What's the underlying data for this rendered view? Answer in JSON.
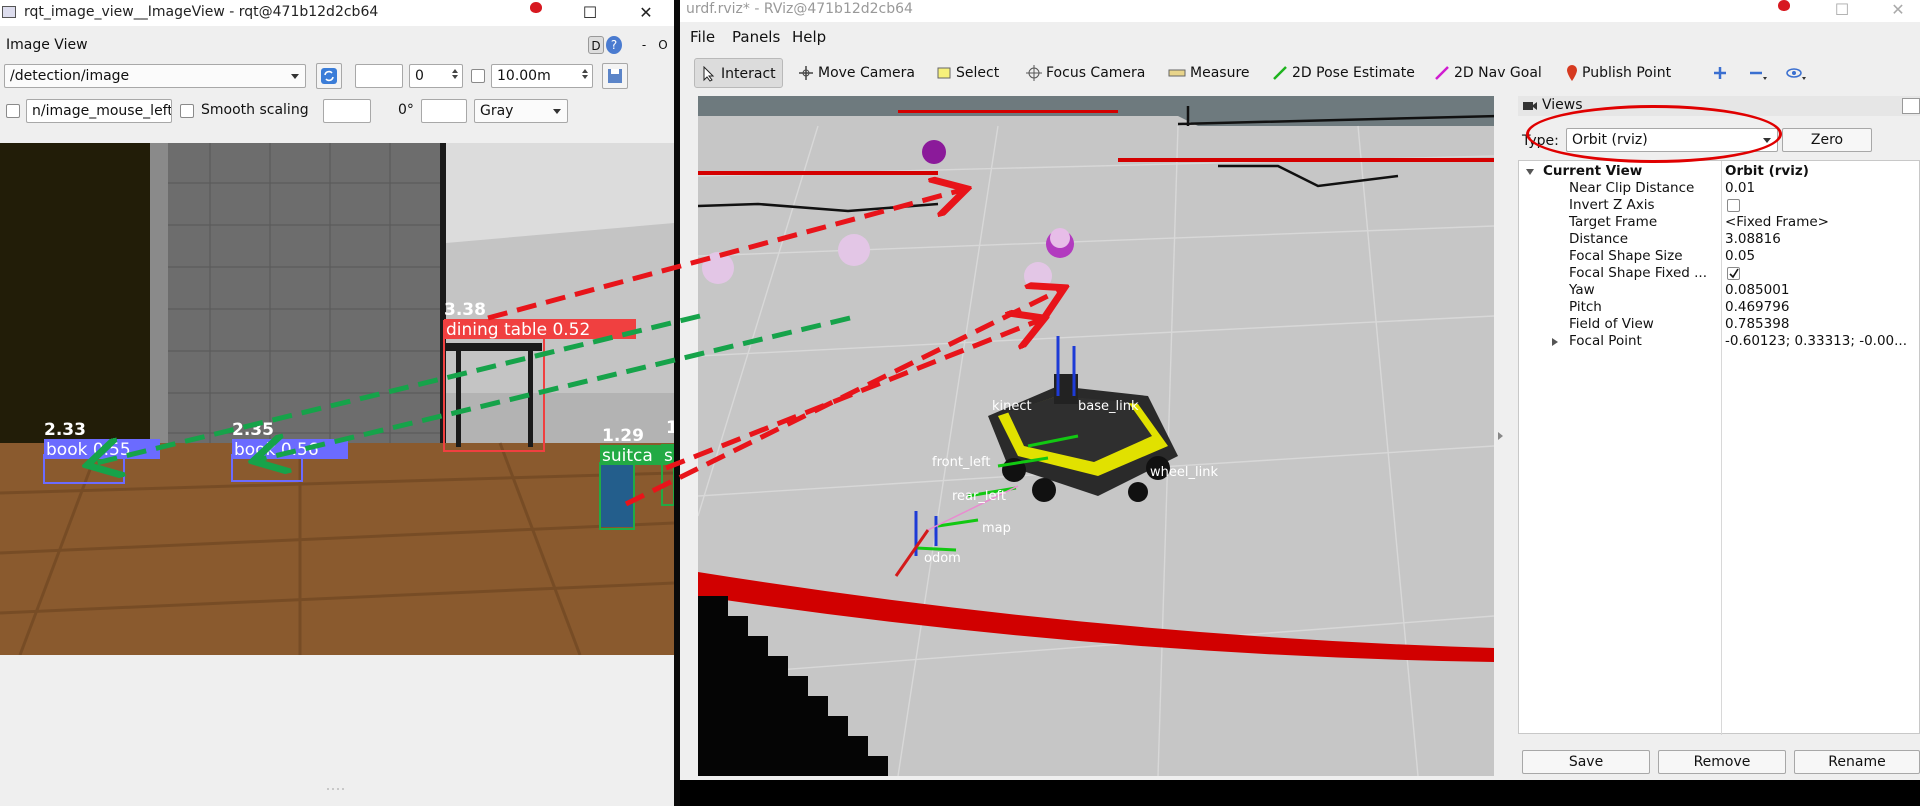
{
  "rqt": {
    "title": "rqt_image_view__ImageView - rqt@471b12d2cb64",
    "plugin_label": "Image View",
    "plugin_buttons": [
      "D",
      "?",
      "-",
      "O"
    ],
    "topic": "/detection/image",
    "min_value": "",
    "max_value": "0",
    "range_value": "10.00m",
    "mouse_topic": "n/image_mouse_left",
    "smooth_scaling_label": "Smooth scaling",
    "rotation_value": "0°",
    "color_scheme": "Gray",
    "detections": [
      {
        "distance": "2.33",
        "label": "book 0.55"
      },
      {
        "distance": "2.35",
        "label": "book 0.56"
      },
      {
        "distance": "3.38",
        "label": "dining table 0.52"
      },
      {
        "distance": "1.29",
        "label": "suitca"
      },
      {
        "distance": "1",
        "label": "s"
      }
    ]
  },
  "rviz": {
    "title": "urdf.rviz* - RViz@471b12d2cb64",
    "menu": [
      "File",
      "Panels",
      "Help"
    ],
    "tools": [
      "Interact",
      "Move Camera",
      "Select",
      "Focus Camera",
      "Measure",
      "2D Pose Estimate",
      "2D Nav Goal",
      "Publish Point"
    ],
    "frame_labels": [
      "base_link",
      "front_left",
      "rear_left",
      "wheel_link",
      "map",
      "odom",
      "kinect"
    ],
    "views_panel": {
      "title": "Views",
      "type_label": "Type:",
      "type_value": "Orbit (rviz)",
      "zero_button": "Zero",
      "current_view_label": "Current View",
      "current_view_value": "Orbit (rviz)",
      "properties": [
        {
          "key": "Near Clip Distance",
          "value": "0.01"
        },
        {
          "key": "Invert Z Axis",
          "value": ""
        },
        {
          "key": "Target Frame",
          "value": "<Fixed Frame>"
        },
        {
          "key": "Distance",
          "value": "3.08816"
        },
        {
          "key": "Focal Shape Size",
          "value": "0.05"
        },
        {
          "key": "Focal Shape Fixed ...",
          "value": ""
        },
        {
          "key": "Yaw",
          "value": "0.085001"
        },
        {
          "key": "Pitch",
          "value": "0.469796"
        },
        {
          "key": "Field of View",
          "value": "0.785398"
        },
        {
          "key": "Focal Point",
          "value": "-0.60123; 0.33313; -0.00..."
        }
      ],
      "invert_z_checked": false,
      "focal_shape_fixed_checked": true,
      "buttons": [
        "Save",
        "Remove",
        "Rename"
      ]
    }
  },
  "colors": {
    "annotation_red": "#e8141a",
    "annotation_green": "#16a34a",
    "highlight_ellipse": "#e00000",
    "laser_red": "#d40000",
    "detection_red": "#f04040",
    "detection_blue": "#6b6bff",
    "detection_green": "#22aa44"
  }
}
